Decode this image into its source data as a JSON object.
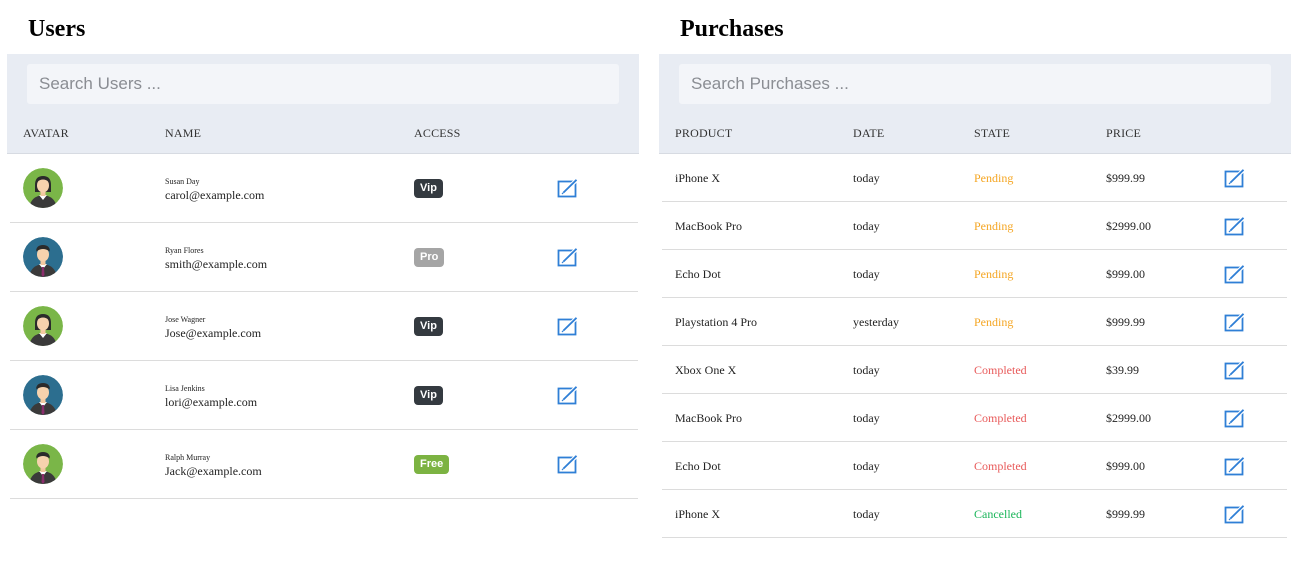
{
  "users": {
    "title": "Users",
    "search_placeholder": "Search Users ...",
    "columns": [
      "AVATAR",
      "NAME",
      "ACCESS"
    ],
    "rows": [
      {
        "name": "Susan Day",
        "email": "carol@example.com",
        "access": "Vip",
        "access_color": "#343a40",
        "avatar": "female-avatar-green"
      },
      {
        "name": "Ryan Flores",
        "email": "smith@example.com",
        "access": "Pro",
        "access_color": "#a5a5a5",
        "avatar": "male-avatar-blue"
      },
      {
        "name": "Jose Wagner",
        "email": "Jose@example.com",
        "access": "Vip",
        "access_color": "#343a40",
        "avatar": "female-avatar-green"
      },
      {
        "name": "Lisa Jenkins",
        "email": "lori@example.com",
        "access": "Vip",
        "access_color": "#343a40",
        "avatar": "male-avatar-blue"
      },
      {
        "name": "Ralph Murray",
        "email": "Jack@example.com",
        "access": "Free",
        "access_color": "#7cb342",
        "avatar": "male-avatar-green"
      }
    ],
    "edit_icon": "edit-icon"
  },
  "purchases": {
    "title": "Purchases",
    "search_placeholder": "Search Purchases ...",
    "columns": [
      "PRODUCT",
      "DATE",
      "STATE",
      "PRICE"
    ],
    "rows": [
      {
        "product": "iPhone X",
        "date": "today",
        "state": "Pending",
        "price": "$999.99"
      },
      {
        "product": "MacBook Pro",
        "date": "today",
        "state": "Pending",
        "price": "$2999.00"
      },
      {
        "product": "Echo Dot",
        "date": "today",
        "state": "Pending",
        "price": "$999.00"
      },
      {
        "product": "Playstation 4 Pro",
        "date": "yesterday",
        "state": "Pending",
        "price": "$999.99"
      },
      {
        "product": "Xbox One X",
        "date": "today",
        "state": "Completed",
        "price": "$39.99"
      },
      {
        "product": "MacBook Pro",
        "date": "today",
        "state": "Completed",
        "price": "$2999.00"
      },
      {
        "product": "Echo Dot",
        "date": "today",
        "state": "Completed",
        "price": "$999.00"
      },
      {
        "product": "iPhone X",
        "date": "today",
        "state": "Cancelled",
        "price": "$999.99"
      }
    ],
    "state_colors": {
      "Pending": "#f5a623",
      "Completed": "#e85a5a",
      "Cancelled": "#1ab55a"
    },
    "edit_icon": "edit-icon"
  },
  "colors": {
    "header_band": "#e8ecf3",
    "edit_icon": "#2f7fd6"
  }
}
